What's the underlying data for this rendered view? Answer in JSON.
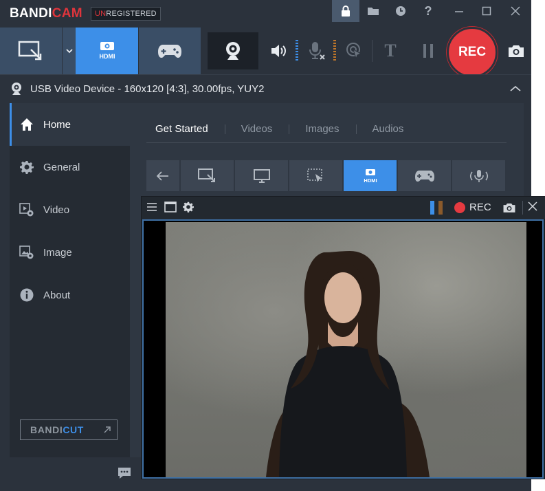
{
  "app": {
    "logo_main": "BANDI",
    "logo_red": "CAM",
    "unreg_red": "UN",
    "unreg_rest": "REGISTERED",
    "help_label": "?"
  },
  "toolbar": {
    "text_tool_label": "T",
    "rec_label": "REC"
  },
  "device": {
    "label": "USB Video Device - 160x120 [4:3], 30.00fps, YUY2"
  },
  "sidebar": {
    "items": [
      {
        "label": "Home",
        "icon": "home-icon",
        "active": true
      },
      {
        "label": "General",
        "icon": "gear-icon",
        "active": false
      },
      {
        "label": "Video",
        "icon": "video-settings-icon",
        "active": false
      },
      {
        "label": "Image",
        "icon": "image-settings-icon",
        "active": false
      },
      {
        "label": "About",
        "icon": "info-icon",
        "active": false
      }
    ],
    "bandicut_prefix": "BANDI",
    "bandicut_suffix": "CUT"
  },
  "main": {
    "tabs": [
      "Get Started",
      "Videos",
      "Images",
      "Audios"
    ],
    "active_tab": "Get Started",
    "mode_buttons": [
      "back-icon",
      "rectangle-icon",
      "fullscreen-icon",
      "around-mouse-icon",
      "hdmi-icon",
      "game-icon",
      "audio-only-icon"
    ],
    "active_mode": "hdmi-icon"
  },
  "overlay": {
    "rec_label": "REC"
  },
  "colors": {
    "accent": "#3d8fe8",
    "rec_red": "#e53a40",
    "background": "#2b323c"
  }
}
